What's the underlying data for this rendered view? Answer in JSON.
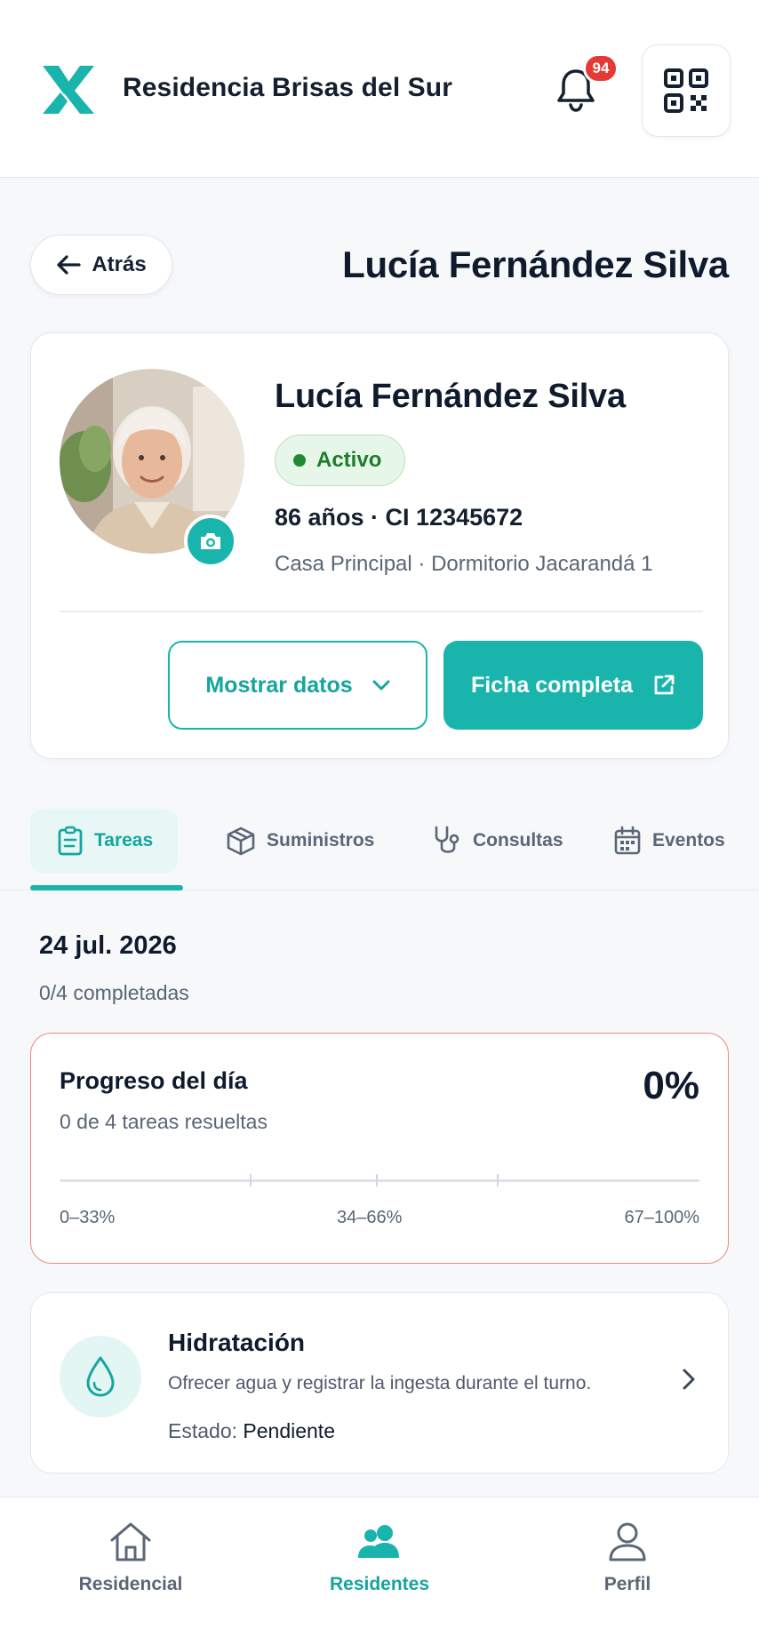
{
  "header": {
    "app_title": "Residencia Brisas del Sur",
    "notification_count": "94",
    "logo_icon": "x-logo-icon",
    "accent_color": "#19b5ad"
  },
  "nav": {
    "back_label": "Atrás",
    "page_title": "Lucía Fernández Silva"
  },
  "resident": {
    "name": "Lucía Fernández Silva",
    "status": "Activo",
    "status_color": "#1f8a33",
    "age_id": "86 años · CI 12345672",
    "location": "Casa Principal · Dormitorio Jacarandá 1",
    "show_data_label": "Mostrar datos",
    "full_record_label": "Ficha completa"
  },
  "tabs": [
    {
      "label": "Tareas",
      "icon": "clipboard-icon",
      "active": true
    },
    {
      "label": "Suministros",
      "icon": "box-icon",
      "active": false
    },
    {
      "label": "Consultas",
      "icon": "stethoscope-icon",
      "active": false
    },
    {
      "label": "Eventos",
      "icon": "calendar-icon",
      "active": false
    }
  ],
  "day": {
    "date": "24 jul. 2026",
    "completed": "0/4 completadas"
  },
  "progress": {
    "title": "Progreso del día",
    "subtitle": "0 de 4 tareas resueltas",
    "percent_label": "0%",
    "percent_value": 0,
    "ranges": [
      "0–33%",
      "34–66%",
      "67–100%"
    ],
    "border_color": "#ee8a7c"
  },
  "task": {
    "title": "Hidratación",
    "description": "Ofrecer agua y registrar la ingesta durante el turno.",
    "status_label": "Estado:",
    "status_value": "Pendiente",
    "icon": "water-drop-icon"
  },
  "bottom_nav": [
    {
      "label": "Residencial",
      "icon": "home-icon",
      "active": false
    },
    {
      "label": "Residentes",
      "icon": "users-icon",
      "active": true
    },
    {
      "label": "Perfil",
      "icon": "user-icon",
      "active": false
    }
  ]
}
